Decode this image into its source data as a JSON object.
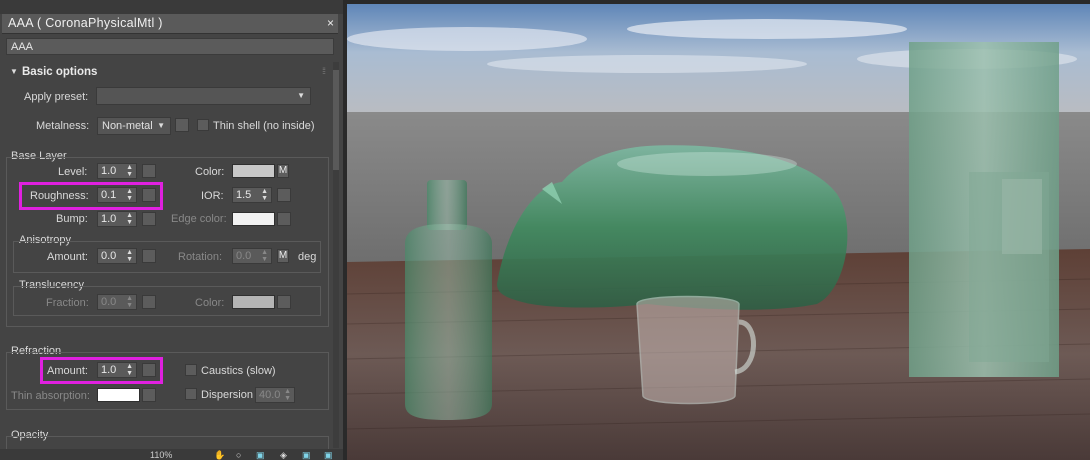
{
  "material": {
    "title": "AAA  ( CoronaPhysicalMtl )",
    "close": "×",
    "name": "AAA"
  },
  "basic_options": {
    "header": "Basic options",
    "apply_preset_label": "Apply preset:",
    "apply_preset_value": "",
    "metalness_label": "Metalness:",
    "metalness_value": "Non-metal",
    "thin_shell_label": "Thin shell (no inside)"
  },
  "base_layer": {
    "header": "Base Layer",
    "level_label": "Level:",
    "level_value": "1.0",
    "color_label": "Color:",
    "roughness_label": "Roughness:",
    "roughness_value": "0.1",
    "ior_label": "IOR:",
    "ior_value": "1.5",
    "bump_label": "Bump:",
    "bump_value": "1.0",
    "edge_color_label": "Edge color:",
    "anisotropy_header": "Anisotropy",
    "aniso_amount_label": "Amount:",
    "aniso_amount_value": "0.0",
    "rotation_label": "Rotation:",
    "rotation_value": "0.0",
    "deg_label": "deg",
    "translucency_header": "Translucency",
    "fraction_label": "Fraction:",
    "fraction_value": "0.0",
    "trans_color_label": "Color:",
    "map_button": "M"
  },
  "refraction": {
    "header": "Refraction",
    "amount_label": "Amount:",
    "amount_value": "1.0",
    "caustics_label": "Caustics (slow)",
    "thin_absorption_label": "Thin absorption:",
    "dispersion_label": "Dispersion",
    "dispersion_value": "40.0"
  },
  "opacity": {
    "header": "Opacity"
  },
  "status": {
    "zoom": "110%"
  },
  "colors": {
    "highlight": "#e020e0",
    "panel_bg": "#444444"
  }
}
